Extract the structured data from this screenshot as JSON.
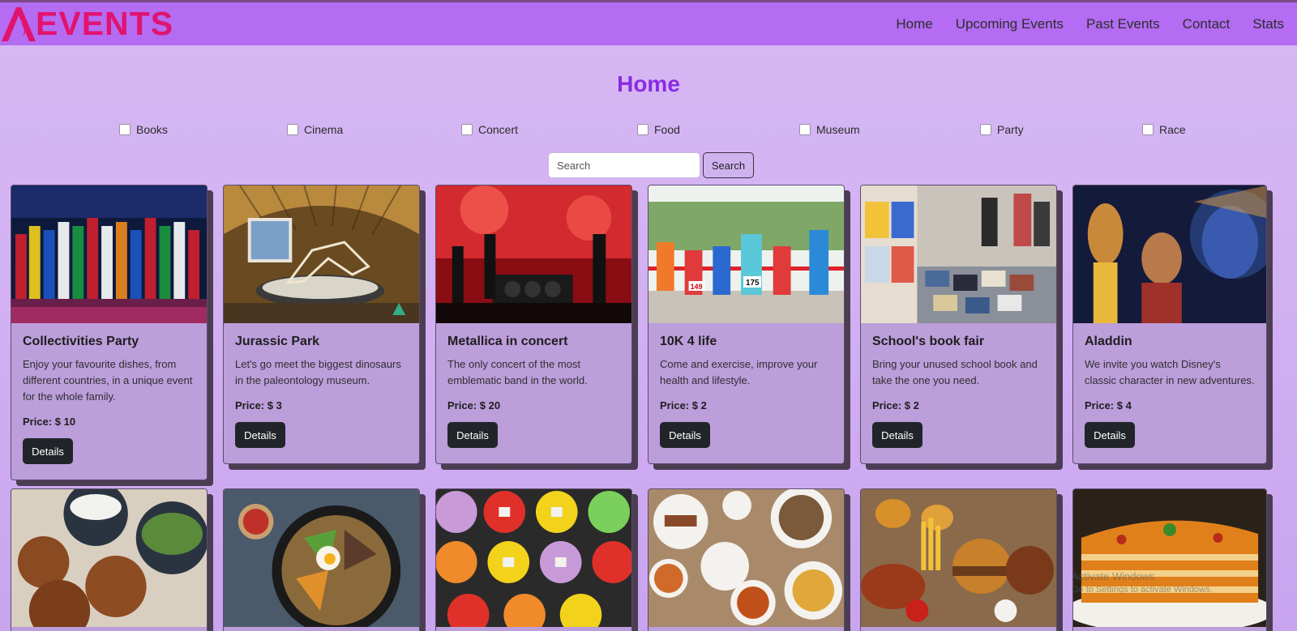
{
  "brand": {
    "name": "EVENTS",
    "logo_letter": "A"
  },
  "nav": [
    {
      "label": "Home"
    },
    {
      "label": "Upcoming Events"
    },
    {
      "label": "Past Events"
    },
    {
      "label": "Contact"
    },
    {
      "label": "Stats"
    }
  ],
  "page": {
    "title": "Home"
  },
  "filters": [
    {
      "label": "Books"
    },
    {
      "label": "Cinema"
    },
    {
      "label": "Concert"
    },
    {
      "label": "Food"
    },
    {
      "label": "Museum"
    },
    {
      "label": "Party"
    },
    {
      "label": "Race"
    }
  ],
  "search": {
    "placeholder": "Search",
    "button_label": "Search"
  },
  "cards": [
    {
      "title": "Collectivities Party",
      "description": "Enjoy your favourite dishes, from different countries, in a unique event for the whole family.",
      "price": "Price: $ 10",
      "button": "Details",
      "image": "party-flags-image"
    },
    {
      "title": "Jurassic Park",
      "description": "Let's go meet the biggest dinosaurs in the paleontology museum.",
      "price": "Price: $ 3",
      "button": "Details",
      "image": "dinosaur-museum-image"
    },
    {
      "title": "Metallica in concert",
      "description": "The only concert of the most emblematic band in the world.",
      "price": "Price: $ 20",
      "button": "Details",
      "image": "rock-concert-image"
    },
    {
      "title": "10K 4 life",
      "description": "Come and exercise, improve your health and lifestyle.",
      "price": "Price: $ 2",
      "button": "Details",
      "image": "running-race-image"
    },
    {
      "title": "School's book fair",
      "description": "Bring your unused school book and take the one you need.",
      "price": "Price: $ 2",
      "button": "Details",
      "image": "book-fair-image"
    },
    {
      "title": "Aladdin",
      "description": "We invite you watch Disney's classic character in new adventures.",
      "price": "Price: $ 4",
      "button": "Details",
      "image": "movie-poster-image"
    }
  ],
  "row2_images": [
    "falafel-image",
    "bibimbap-image",
    "sushi-plates-image",
    "food-platter-image",
    "burger-fries-image",
    "lasagna-image"
  ],
  "watermark": {
    "line1": "Activate Windows",
    "line2": "Go to Settings to activate Windows."
  }
}
